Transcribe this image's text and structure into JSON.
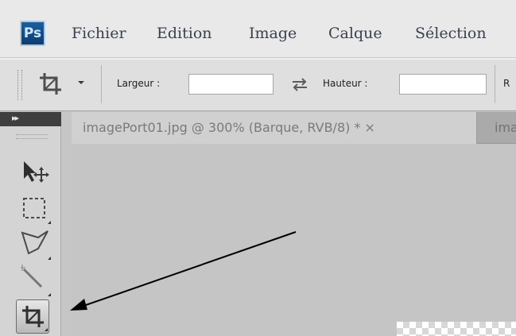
{
  "app": {
    "logo_text": "Ps",
    "brand_color": "#1a5f9f"
  },
  "menu": {
    "items": [
      "Fichier",
      "Edition",
      "Image",
      "Calque",
      "Sélection"
    ]
  },
  "options_bar": {
    "width_label": "Largeur :",
    "width_value": "",
    "height_label": "Hauteur :",
    "height_value": "",
    "swap_icon": "swap-arrows-icon",
    "truncated_label": "R"
  },
  "tools_panel": {
    "collapse_label": "▸▸",
    "tools": [
      {
        "name": "move-tool",
        "icon": "move-icon"
      },
      {
        "name": "rectangular-marquee-tool",
        "icon": "marquee-icon"
      },
      {
        "name": "lasso-tool",
        "icon": "polygonal-lasso-icon"
      },
      {
        "name": "quick-selection-tool",
        "icon": "magic-wand-icon"
      },
      {
        "name": "crop-tool",
        "icon": "crop-icon",
        "active": true
      }
    ]
  },
  "document": {
    "tab_title": "imagePort01.jpg @ 300% (Barque, RVB/8) * ×",
    "second_tab_title": "ima"
  },
  "annotation": {
    "type": "arrow",
    "points_to": "crop-tool",
    "color": "#000000"
  }
}
